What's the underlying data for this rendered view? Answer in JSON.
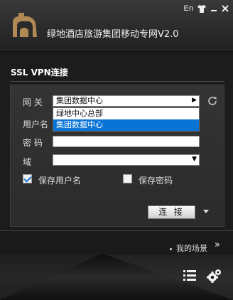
{
  "header": {
    "title": "绿地酒店旅游集团移动专网V2.0",
    "lang_label": "En"
  },
  "section": {
    "title": "SSL VPN连接"
  },
  "form": {
    "gateway_label": "网 关",
    "gateway_value": "集团数据中心",
    "gateway_options": [
      "绿地中心总部",
      "集团数据中心"
    ],
    "username_label": "用户名",
    "username_value": "",
    "password_label": "密 码",
    "password_value": "",
    "domain_label": "域",
    "domain_value": "",
    "save_username_label": "保存用户名",
    "save_username_checked": true,
    "save_password_label": "保存密码",
    "save_password_checked": false,
    "connect_label": "连 接"
  },
  "scene": {
    "label": "我的场景",
    "arrow": "»"
  },
  "colors": {
    "accent": "#0a74d6",
    "background": "#1c1c1c"
  },
  "icons": [
    "logo-icon",
    "shirt-icon",
    "minimize-icon",
    "close-icon",
    "refresh-icon",
    "menu-icon",
    "gear-icon"
  ]
}
